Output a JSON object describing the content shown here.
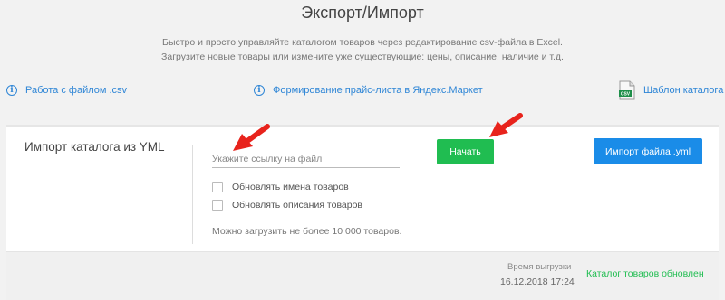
{
  "header": {
    "title": "Экспорт/Импорт",
    "subtitle_line1": "Быстро и просто управляйте каталогом товаров через редактирование csv-файла в Excel.",
    "subtitle_line2": "Загрузите новые товары или измените уже существующие: цены, описание, наличие и т.д."
  },
  "links": {
    "csv_work": "Работа с файлом .csv",
    "yandex_price": "Формирование прайс-листа в Яндекс.Маркет",
    "catalog_template": "Шаблон каталога",
    "csv_badge": "CSV"
  },
  "import_card": {
    "title": "Импорт каталога из YML",
    "url_input_value": "",
    "url_input_placeholder": "Укажите ссылку на файл",
    "checkbox_update_names": "Обновлять имена товаров",
    "checkbox_update_descriptions": "Обновлять описания товаров",
    "note": "Можно загрузить не более 10 000 товаров.",
    "start_button": "Начать",
    "import_file_button": "Импорт файла .yml"
  },
  "footer": {
    "upload_time_label": "Время выгрузки",
    "upload_time_value": "16.12.2018 17:24",
    "status": "Каталог товаров обновлен"
  },
  "colors": {
    "accent_blue": "#1a8ce8",
    "accent_green": "#20bd51",
    "link_blue": "#2f86d6",
    "arrow_red": "#e8231c"
  }
}
